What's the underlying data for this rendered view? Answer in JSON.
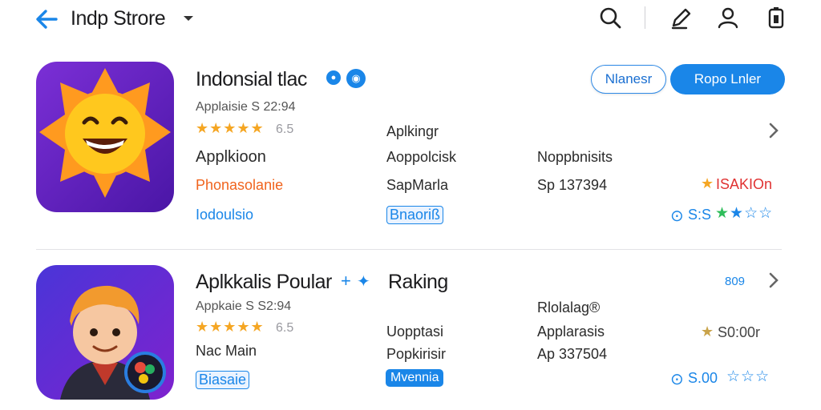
{
  "header": {
    "title": "Indp Strore",
    "icons": [
      "back-arrow-icon",
      "chevron-down-icon",
      "search-icon",
      "edit-icon",
      "profile-icon",
      "battery-icon"
    ]
  },
  "app1": {
    "title": "Indonsial tlac",
    "meta": "Applaisie S 22:94",
    "rating_count": "6.5",
    "row1": {
      "c2": "Aplkingr"
    },
    "row2": {
      "c1": "Applkioon",
      "c2": "Aoppolcisk",
      "c3": "Noppbnisits"
    },
    "row3": {
      "c1": "Phonasolanie",
      "c2": "SapMarla",
      "c3": "Sp 137394",
      "c4": "ISAKIOn"
    },
    "row4": {
      "c1": "Iodoulsio",
      "c2": "Bnaoriß",
      "c4": "S:S"
    },
    "button_outline": "Nlanesr",
    "button_filled": "Ropo Lnler"
  },
  "app2": {
    "title": "Aplkkalis Poular",
    "title_tag": "Raking",
    "meta": "Appkaie S S2:94",
    "rating_count": "6.5",
    "top_right": "809",
    "row1": {
      "c3": "Rlolalag®"
    },
    "row2": {
      "c1": "Nac Main",
      "c2": "Uopptasi",
      "c3": "Applarasis",
      "c4": "S0:00r"
    },
    "row3": {
      "c2": "Popkirisir",
      "c3": "Ap 337504"
    },
    "row4": {
      "c1": "Biasaie",
      "c2": "Mvennia",
      "c4": "S.00"
    }
  },
  "colors": {
    "accent": "#1a86e8",
    "star": "#f5a623",
    "orange": "#f0641e",
    "red": "#e03232"
  }
}
